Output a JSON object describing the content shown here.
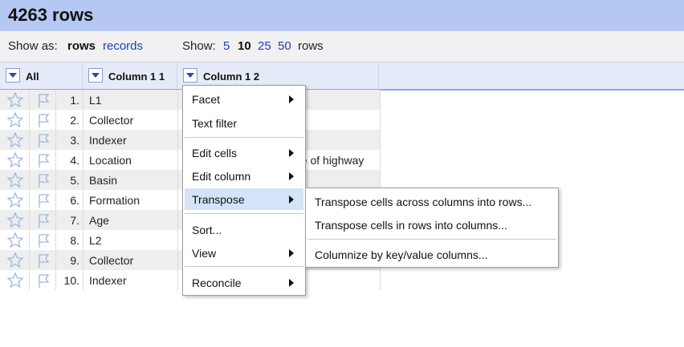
{
  "header": {
    "title": "4263 rows"
  },
  "controls": {
    "show_as_label": "Show as:",
    "rows_option": "rows",
    "records_option": "records",
    "show_label": "Show:",
    "page_sizes": [
      "5",
      "10",
      "25",
      "50"
    ],
    "selected_page_size": "10",
    "rows_suffix": "rows"
  },
  "columns": {
    "all": "All",
    "col1": "Column 1 1",
    "col2": "Column 1 2"
  },
  "rows": [
    {
      "num": "1.",
      "col1": "L1",
      "col2": ""
    },
    {
      "num": "2.",
      "col1": "Collector",
      "col2": ""
    },
    {
      "num": "3.",
      "col1": "Indexer",
      "col2": ""
    },
    {
      "num": "4.",
      "col1": "Location",
      "col2": "de of highway"
    },
    {
      "num": "5.",
      "col1": "Basin",
      "col2": ""
    },
    {
      "num": "6.",
      "col1": "Formation",
      "col2": ""
    },
    {
      "num": "7.",
      "col1": "Age",
      "col2": ""
    },
    {
      "num": "8.",
      "col1": "L2",
      "col2": ""
    },
    {
      "num": "9.",
      "col1": "Collector",
      "col2": ""
    },
    {
      "num": "10.",
      "col1": "Indexer",
      "col2": ""
    }
  ],
  "column_menu": {
    "facet": "Facet",
    "text_filter": "Text filter",
    "edit_cells": "Edit cells",
    "edit_column": "Edit column",
    "transpose": "Transpose",
    "sort": "Sort...",
    "view": "View",
    "reconcile": "Reconcile"
  },
  "transpose_submenu": {
    "across_columns": "Transpose cells across columns into rows...",
    "rows_into_columns": "Transpose cells in rows into columns...",
    "columnize": "Columnize by key/value columns..."
  },
  "colors": {
    "header_bg": "#b5c8f4",
    "link": "#1d3fb7",
    "menu_highlight": "#d4e3f7"
  }
}
